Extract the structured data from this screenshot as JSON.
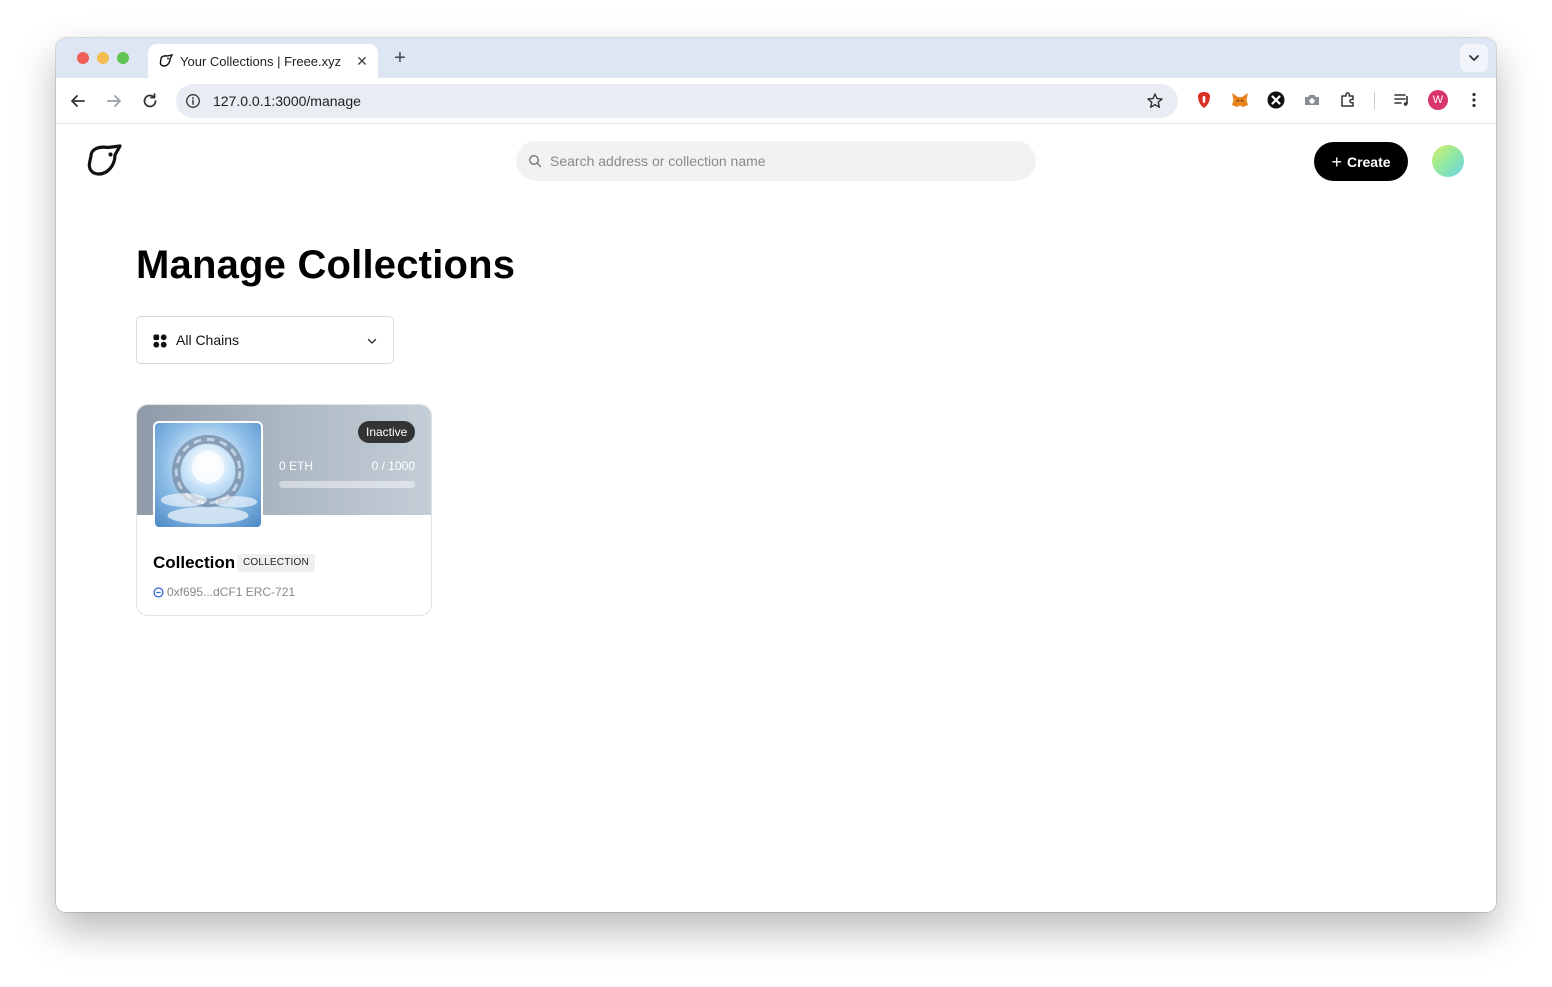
{
  "browser": {
    "tab_title": "Your Collections | Freee.xyz",
    "url": "127.0.0.1:3000/manage",
    "profile_initial": "W",
    "new_tab": "+",
    "close": "✕"
  },
  "header": {
    "search_placeholder": "Search address or collection name",
    "create_label": "Create",
    "create_plus": "+"
  },
  "main": {
    "title": "Manage Collections",
    "chain_filter": "All Chains"
  },
  "collections": [
    {
      "name": "Collection",
      "type": "COLLECTION",
      "status": "Inactive",
      "price": "0 ETH",
      "supply": "0 / 1000",
      "progress": 0,
      "meta": "0xf695...dCF1 ERC-721"
    }
  ],
  "colors": {
    "accent": "#000000",
    "chain_eth": "#3b6fd8",
    "profile": "#d8366a"
  }
}
